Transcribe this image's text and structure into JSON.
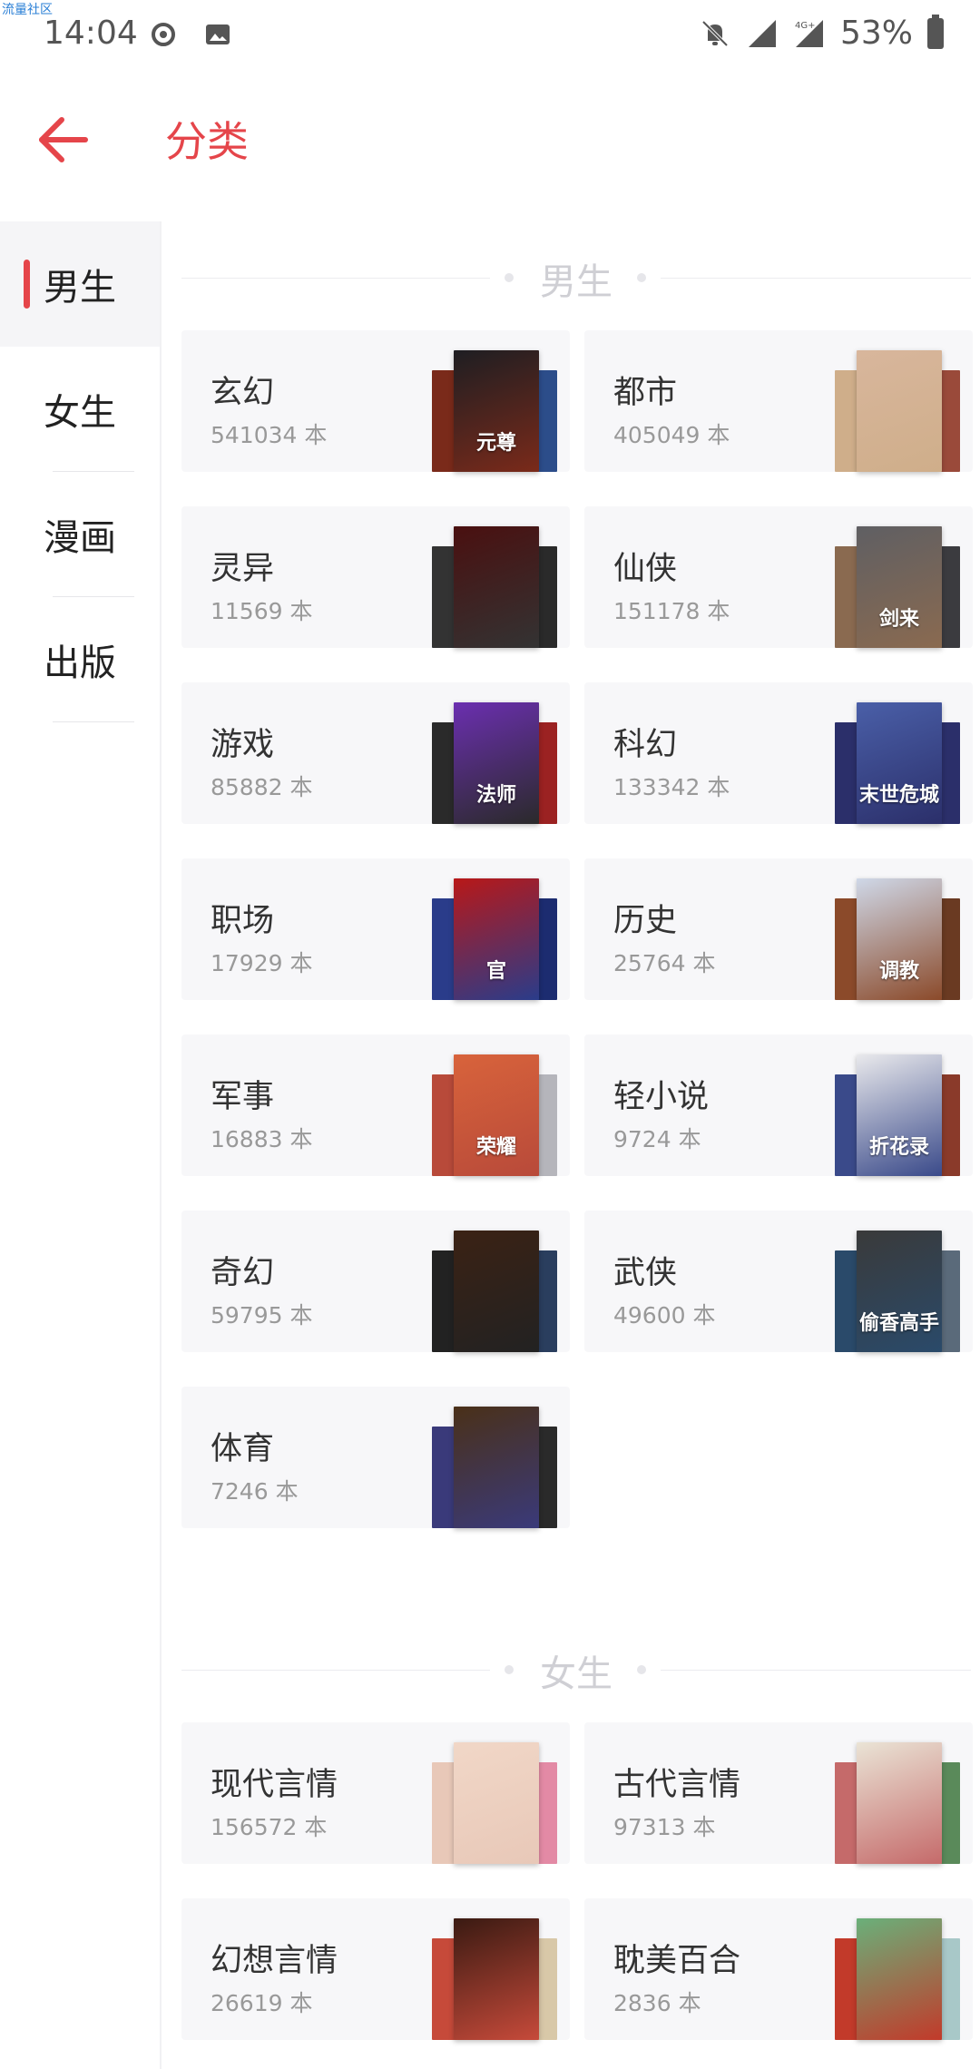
{
  "watermark": "流量社区",
  "status_bar": {
    "time": "14:04",
    "left_icons": [
      "cyclone-icon",
      "image-icon"
    ],
    "right_icons": [
      "notifications-off-icon",
      "signal-icon",
      "signal-4g-icon",
      "battery-icon"
    ],
    "battery": "53%",
    "network": "4G+"
  },
  "app_bar": {
    "back_icon": "arrow-left-icon",
    "title": "分类",
    "accent_color": "#e5454a"
  },
  "sidebar": {
    "items": [
      {
        "label": "男生",
        "active": true
      },
      {
        "label": "女生",
        "active": false
      },
      {
        "label": "漫画",
        "active": false
      },
      {
        "label": "出版",
        "active": false
      }
    ]
  },
  "sections": [
    {
      "title": "男生",
      "categories": [
        {
          "name": "玄幻",
          "count": "541034 本",
          "cover_text": "元尊",
          "cover_colors": [
            "#7a2a1a",
            "#1e1e22",
            "#2c4d8a"
          ]
        },
        {
          "name": "都市",
          "count": "405049 本",
          "cover_text": "",
          "cover_colors": [
            "#cfae8a",
            "#d8b69c",
            "#9a4a3a"
          ]
        },
        {
          "name": "灵异",
          "count": "11569 本",
          "cover_text": "",
          "cover_colors": [
            "#333",
            "#4a1010",
            "#2a2a2a"
          ]
        },
        {
          "name": "仙侠",
          "count": "151178 本",
          "cover_text": "剑来",
          "cover_colors": [
            "#8a6a50",
            "#5f5f63",
            "#3b3b3f"
          ]
        },
        {
          "name": "游戏",
          "count": "85882 本",
          "cover_text": "法师",
          "cover_colors": [
            "#2a2a2a",
            "#6b2fb0",
            "#9b2222"
          ]
        },
        {
          "name": "科幻",
          "count": "133342 本",
          "cover_text": "末世危城",
          "cover_colors": [
            "#2b2f6a",
            "#4a5fa8",
            "#2b2f6a"
          ]
        },
        {
          "name": "职场",
          "count": "17929 本",
          "cover_text": "官",
          "cover_colors": [
            "#2a3c8a",
            "#b81818",
            "#1c2c70"
          ]
        },
        {
          "name": "历史",
          "count": "25764 本",
          "cover_text": "调教",
          "cover_colors": [
            "#8b4a2a",
            "#cfd8e8",
            "#6a3a22"
          ]
        },
        {
          "name": "军事",
          "count": "16883 本",
          "cover_text": "荣耀",
          "cover_colors": [
            "#b84a3a",
            "#d8633b",
            "#b5b5bb"
          ]
        },
        {
          "name": "轻小说",
          "count": "9724 本",
          "cover_text": "折花录",
          "cover_colors": [
            "#3a4a8a",
            "#e9e9ec",
            "#8a3a2a"
          ]
        },
        {
          "name": "奇幻",
          "count": "59795 本",
          "cover_text": "",
          "cover_colors": [
            "#222",
            "#3b2214",
            "#2a3e5e"
          ]
        },
        {
          "name": "武侠",
          "count": "49600 本",
          "cover_text": "偷香高手",
          "cover_colors": [
            "#2a4a6a",
            "#3a3a3a",
            "#5a6a7a"
          ]
        },
        {
          "name": "体育",
          "count": "7246 本",
          "cover_text": "",
          "cover_colors": [
            "#3a3a7a",
            "#4a3018",
            "#2a2a2a"
          ]
        }
      ]
    },
    {
      "title": "女生",
      "categories": [
        {
          "name": "现代言情",
          "count": "156572 本",
          "cover_text": "",
          "cover_colors": [
            "#e8c8b8",
            "#f1d7c7",
            "#e38aa5"
          ]
        },
        {
          "name": "古代言情",
          "count": "97313 本",
          "cover_text": "",
          "cover_colors": [
            "#c56a6a",
            "#eae4d6",
            "#5a8a5a"
          ]
        },
        {
          "name": "幻想言情",
          "count": "26619 本",
          "cover_text": "",
          "cover_colors": [
            "#c64a3a",
            "#3a1a12",
            "#d8c8a8"
          ]
        },
        {
          "name": "耽美百合",
          "count": "2836 本",
          "cover_text": "",
          "cover_colors": [
            "#c23a2a",
            "#6ab07a",
            "#a8c8c8"
          ]
        }
      ]
    }
  ]
}
